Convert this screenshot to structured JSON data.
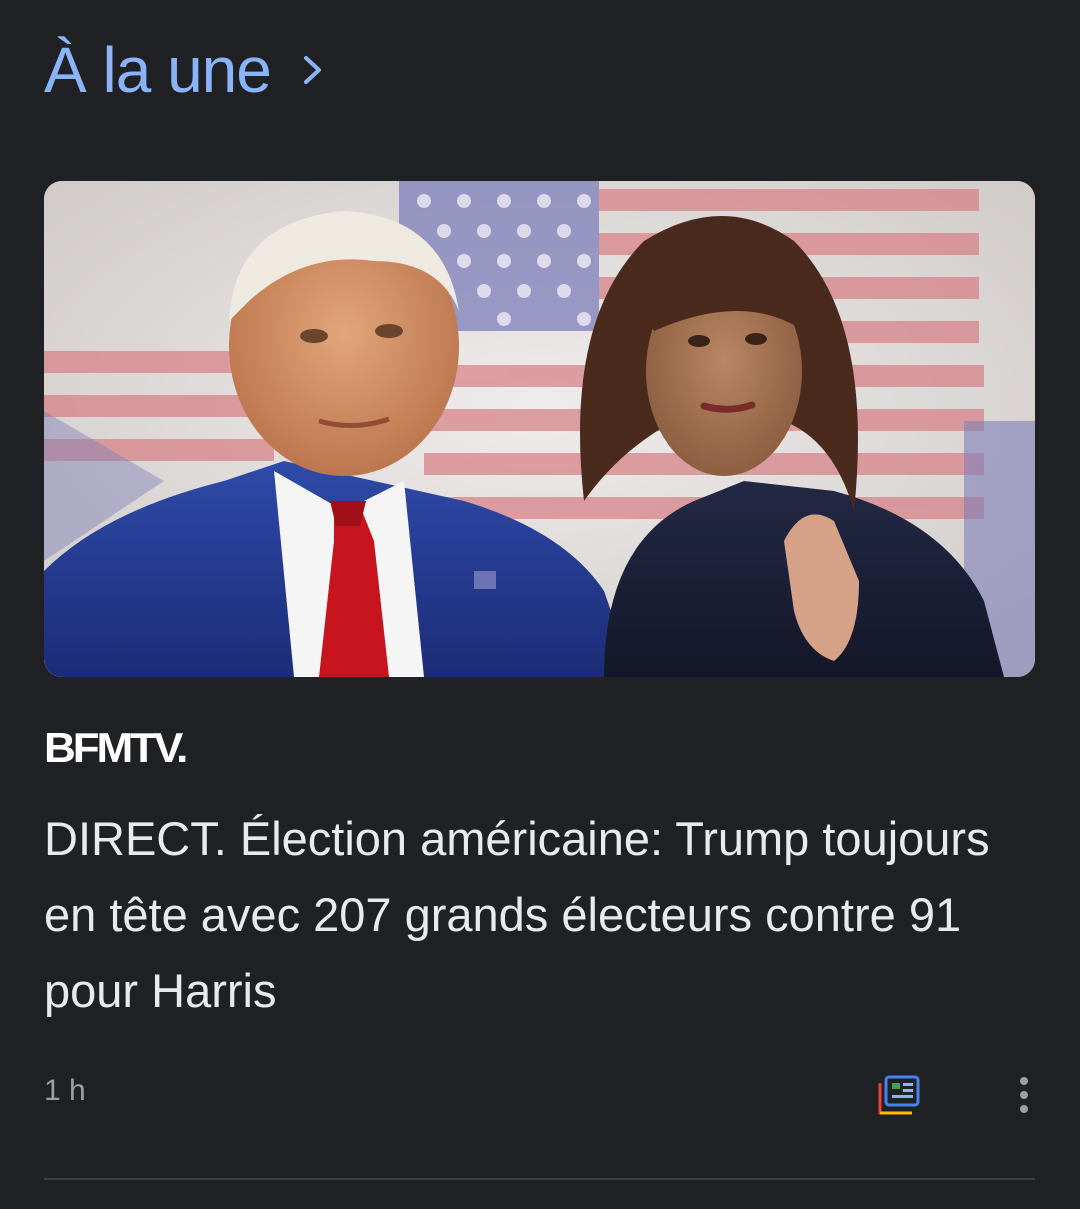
{
  "section": {
    "title": "À la une",
    "chevron_icon": "chevron-right-icon"
  },
  "article": {
    "image_alt": "Donald Trump et Kamala Harris devant un drapeau américain",
    "source_logo": "BFMTV.",
    "headline": "DIRECT. Élection américaine: Trump toujours en tête avec 207 grands électeurs contre 91 pour Harris",
    "time": "1 h",
    "full_coverage_icon": "full-coverage-icon",
    "more_icon": "more-vert-icon"
  },
  "colors": {
    "background": "#202124",
    "accent": "#8ab4f8",
    "headline": "#e8eaed",
    "muted": "#9aa0a6"
  }
}
